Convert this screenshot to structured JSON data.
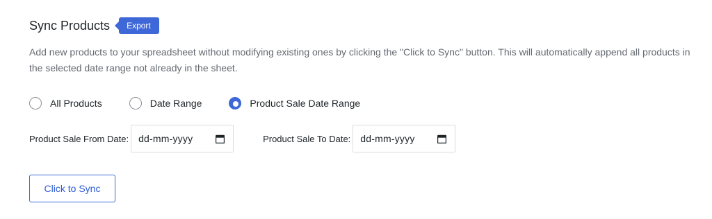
{
  "section": {
    "title": "Sync Products",
    "badge": "Export",
    "description": "Add new products to your spreadsheet without modifying existing ones by clicking the \"Click to Sync\" button. This will automatically append all products in the selected date range not already in the sheet."
  },
  "radio_options": [
    {
      "label": "All Products",
      "checked": false
    },
    {
      "label": "Date Range",
      "checked": false
    },
    {
      "label": "Product Sale Date Range",
      "checked": true
    }
  ],
  "date_fields": {
    "from": {
      "label": "Product Sale From Date:",
      "value": "dd-mm-yyyy",
      "icon": "calendar-icon"
    },
    "to": {
      "label": "Product Sale To Date:",
      "value": "dd-mm-yyyy",
      "icon": "calendar-icon"
    }
  },
  "actions": {
    "sync_label": "Click to Sync"
  },
  "colors": {
    "accent": "#3e67d8",
    "text": "#1d2327",
    "muted": "#646970",
    "border": "#dcdcde"
  }
}
